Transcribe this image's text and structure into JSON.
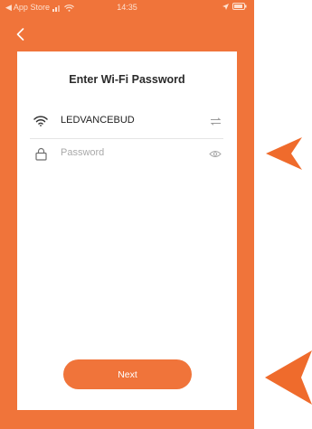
{
  "status_bar": {
    "back_app": "◀ App Store",
    "time": "14:35"
  },
  "header": {
    "back_icon": "chevron-left-icon"
  },
  "card": {
    "title": "Enter Wi-Fi Password",
    "ssid": {
      "icon": "wifi-icon",
      "value": "LEDVANCEBUD",
      "action_icon": "switch-network-icon"
    },
    "password": {
      "icon": "lock-icon",
      "placeholder": "Password",
      "action_icon": "eye-icon"
    },
    "next_label": "Next"
  },
  "annotations": {
    "pointer_color": "#ef6b2c"
  },
  "colors": {
    "accent": "#f0743a",
    "card": "#ffffff",
    "title_text": "#2a2a2a",
    "placeholder_text": "#a9a9a9"
  }
}
